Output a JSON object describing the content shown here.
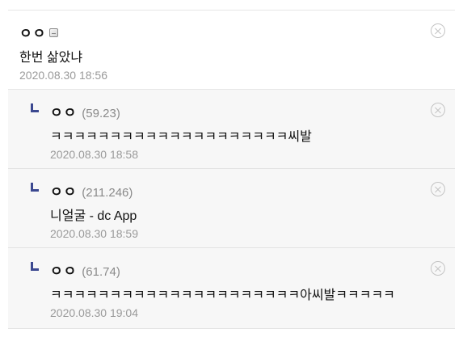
{
  "comment": {
    "author": "ㅇㅇ",
    "gallog_icon": "gallog-icon",
    "text": "한번 삶았냐",
    "date": "2020.08.30 18:56",
    "delete_icon": "close-circle-icon"
  },
  "replies": [
    {
      "author": "ㅇㅇ",
      "ip": "(59.23)",
      "text": "ㅋㅋㅋㅋㅋㅋㅋㅋㅋㅋㅋㅋㅋㅋㅋㅋㅋㅋㅋㅋ씨발",
      "date": "2020.08.30 18:58"
    },
    {
      "author": "ㅇㅇ",
      "ip": "(211.246)",
      "text": "니얼굴 - dc App",
      "date": "2020.08.30 18:59"
    },
    {
      "author": "ㅇㅇ",
      "ip": "(61.74)",
      "text": "ㅋㅋㅋㅋㅋㅋㅋㅋㅋㅋㅋㅋㅋㅋㅋㅋㅋㅋㅋㅋㅋ아씨발ㅋㅋㅋㅋㅋ",
      "date": "2020.08.30 19:04"
    }
  ],
  "colors": {
    "reply_marker": "#3b4890",
    "meta_text": "#9a9a9a",
    "reply_background": "#f7f7f7"
  }
}
